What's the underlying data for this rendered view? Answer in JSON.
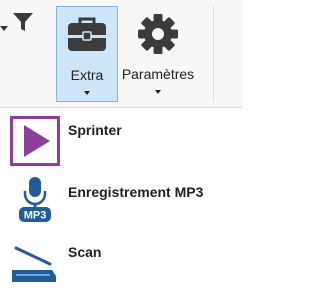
{
  "ribbon": {
    "buttons": [
      {
        "label": "Extra",
        "icon": "toolbox-icon",
        "active": true
      },
      {
        "label": "Paramètres",
        "icon": "gear-icon",
        "active": false
      }
    ],
    "filter_icon": "filter-icon"
  },
  "menu": {
    "items": [
      {
        "label": "Sprinter",
        "icon": "play-icon"
      },
      {
        "label": "Enregistrement MP3",
        "icon": "microphone-mp3-icon"
      },
      {
        "label": "Scan",
        "icon": "scanner-icon"
      }
    ]
  },
  "colors": {
    "active_button_bg": "#cde6f7",
    "active_button_border": "#7fb6e0",
    "sprinter_purple": "#8e3f9e",
    "icon_blue": "#1f5e9b"
  }
}
